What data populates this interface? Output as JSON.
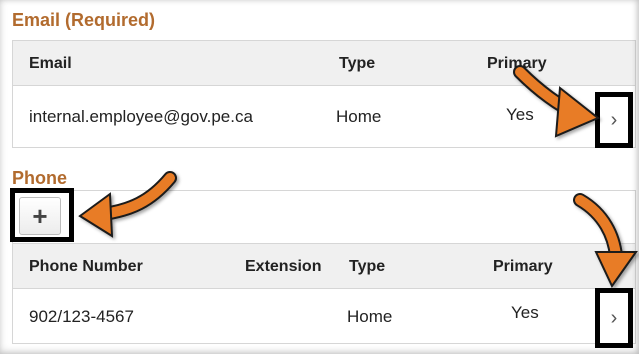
{
  "email_section": {
    "title": "Email (Required)",
    "columns": {
      "email": "Email",
      "type": "Type",
      "primary": "Primary"
    },
    "rows": [
      {
        "email": "internal.employee@gov.pe.ca",
        "type": "Home",
        "primary": "Yes"
      }
    ],
    "detail_icon": "chevron-right-icon"
  },
  "phone_section": {
    "title": "Phone",
    "add_icon": "plus-icon",
    "columns": {
      "number": "Phone Number",
      "extension": "Extension",
      "type": "Type",
      "primary": "Primary"
    },
    "rows": [
      {
        "number": "902/123-4567",
        "extension": "",
        "type": "Home",
        "primary": "Yes"
      }
    ],
    "detail_icon": "chevron-right-icon"
  },
  "colors": {
    "section_title": "#b26b2e",
    "highlight_arrow": "#e87c25",
    "highlight_box": "#000000",
    "header_bg": "#f0f0f0"
  },
  "glyphs": {
    "chevron": "›",
    "plus": "+"
  }
}
